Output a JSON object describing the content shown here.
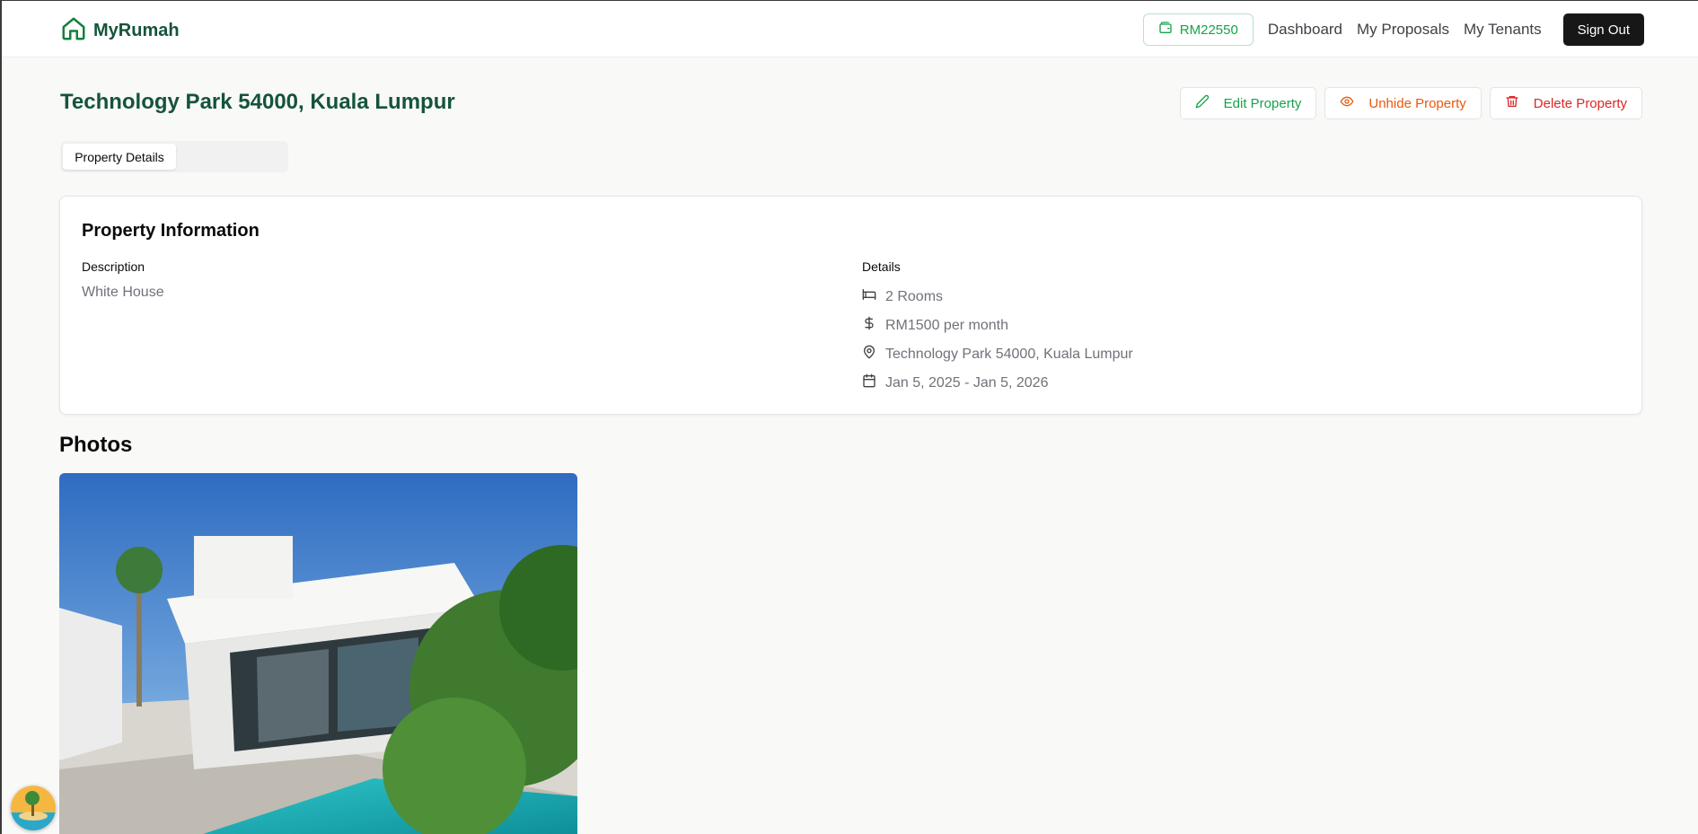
{
  "header": {
    "app_name": "MyRumah",
    "balance": "RM22550",
    "nav": [
      "Dashboard",
      "My Proposals",
      "My Tenants"
    ],
    "sign_out": "Sign Out"
  },
  "page": {
    "title": "Technology Park 54000, Kuala Lumpur",
    "actions": {
      "edit": "Edit Property",
      "unhide": "Unhide Property",
      "delete": "Delete Property"
    },
    "tabs": [
      "Property Details"
    ]
  },
  "info": {
    "card_title": "Property Information",
    "description_label": "Description",
    "description": "White House",
    "details_label": "Details",
    "details": {
      "rooms": "2 Rooms",
      "price": "RM1500 per month",
      "address": "Technology Park 54000, Kuala Lumpur",
      "dates": "Jan 5, 2025 - Jan 5, 2026"
    }
  },
  "photos": {
    "title": "Photos"
  },
  "colors": {
    "brand": "#15543a",
    "accent_green": "#16a34a",
    "unhide_orange": "#ea580c",
    "delete_red": "#dc2626"
  }
}
